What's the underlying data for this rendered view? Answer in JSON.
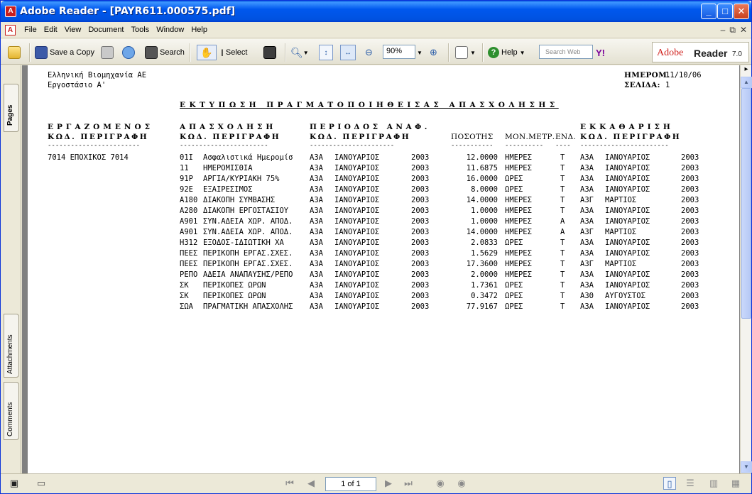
{
  "window": {
    "title": "Adobe Reader - [PAYR611.000575.pdf]",
    "controls": {
      "minimize": "_",
      "maximize": "□",
      "close": "✕"
    }
  },
  "menu": [
    "File",
    "Edit",
    "View",
    "Document",
    "Tools",
    "Window",
    "Help"
  ],
  "toolbar": {
    "save_copy": "Save a Copy",
    "search": "Search",
    "select": "Select",
    "zoom": "90%",
    "help": "Help",
    "search_web_placeholder": "Search Web",
    "yahoo": "Y!",
    "brand": {
      "adobe": "Adobe",
      "reader": "Reader",
      "version": "7.0",
      "accent": "#d0201c"
    }
  },
  "nav_tabs": {
    "pages": "Pages",
    "attachments": "Attachments",
    "comments": "Comments"
  },
  "document": {
    "company": "Ελληνική Βιομηχανία ΑΕ",
    "plant": "Εργοστάσιο Α'",
    "date_label": "ΗΜΕΡΟΜ.",
    "date_value": "11/10/06",
    "page_label": "ΣΕΛΙΔΑ:",
    "page_value": "1",
    "report_title": "ΕΚΤΥΠΩΣΗ ΠΡΑΓΜΑΤΟΠΟΙΗΘΕΙΣΑΣ ΑΠΑΣΧΟΛΗΣΗΣ",
    "group_headers": {
      "employee": "ΕΡΓΑΖΟΜΕΝΟΣ",
      "occupation": "ΑΠΑΣΧΟΛΗΣΗ",
      "period": "ΠΕΡΙΟΔΟΣ ΑΝΑΦ.",
      "settlement": "ΕΚΚΑΘΑΡΙΣΗ"
    },
    "columns": {
      "emp": "ΚΩΔ. ΠΕΡΙΓΡΑΦΗ",
      "occ": "ΚΩΔ. ΠΕΡΙΓΡΑΦΗ",
      "per": "ΚΩΔ. ΠΕΡΙΓΡΑΦΗ",
      "qty": "ΠΟΣΟΤΗΣ",
      "unit": "ΜΟΝ.ΜΕΤΡ.",
      "ind": "ΕΝΔ.",
      "set": "ΚΩΔ. ΠΕΡΙΓΡΑΦΗ"
    },
    "rules": {
      "emp": "------------------------",
      "occ": "-----------------------",
      "per": "----------------------",
      "qty": "-----------",
      "unit": "----------",
      "ind": "----",
      "set": "-----------------------"
    },
    "employee": "7014 ΕΠΟΧΙΚΟΣ 7014",
    "rows": [
      {
        "code": "01Ι",
        "desc": "Ασφαλιστικά Ημερομίσ",
        "pcode": "Α3Α",
        "pdesc": "ΙΑΝΟΥΑΡΙΟΣ",
        "pyear": "2003",
        "qty": "12.0000",
        "unit": "ΗΜΕΡΕΣ",
        "ind": "Τ",
        "scode": "Α3Α",
        "sdesc": "ΙΑΝΟΥΑΡΙΟΣ",
        "syear": "2003"
      },
      {
        "code": "11",
        "desc": "ΗΜΕΡΟΜΙΣΘΙΑ",
        "pcode": "Α3Α",
        "pdesc": "ΙΑΝΟΥΑΡΙΟΣ",
        "pyear": "2003",
        "qty": "11.6875",
        "unit": "ΗΜΕΡΕΣ",
        "ind": "Τ",
        "scode": "Α3Α",
        "sdesc": "ΙΑΝΟΥΑΡΙΟΣ",
        "syear": "2003"
      },
      {
        "code": "91Ρ",
        "desc": "ΑΡΓΙΑ/ΚΥΡΙΑΚΗ 75%",
        "pcode": "Α3Α",
        "pdesc": "ΙΑΝΟΥΑΡΙΟΣ",
        "pyear": "2003",
        "qty": "16.0000",
        "unit": "ΩΡΕΣ",
        "ind": "Τ",
        "scode": "Α3Α",
        "sdesc": "ΙΑΝΟΥΑΡΙΟΣ",
        "syear": "2003"
      },
      {
        "code": "92Ε",
        "desc": "ΕΞΑΙΡΕΣΙΜΟΣ",
        "pcode": "Α3Α",
        "pdesc": "ΙΑΝΟΥΑΡΙΟΣ",
        "pyear": "2003",
        "qty": "8.0000",
        "unit": "ΩΡΕΣ",
        "ind": "Τ",
        "scode": "Α3Α",
        "sdesc": "ΙΑΝΟΥΑΡΙΟΣ",
        "syear": "2003"
      },
      {
        "code": "Α180",
        "desc": "ΔΙΑΚΟΠΗ ΣΥΜΒΑΣΗΣ",
        "pcode": "Α3Α",
        "pdesc": "ΙΑΝΟΥΑΡΙΟΣ",
        "pyear": "2003",
        "qty": "14.0000",
        "unit": "ΗΜΕΡΕΣ",
        "ind": "Τ",
        "scode": "Α3Γ",
        "sdesc": "ΜΑΡΤΙΟΣ",
        "syear": "2003"
      },
      {
        "code": "Α280",
        "desc": "ΔΙΑΚΟΠΗ ΕΡΓΟΣΤΑΣΙΟΥ",
        "pcode": "Α3Α",
        "pdesc": "ΙΑΝΟΥΑΡΙΟΣ",
        "pyear": "2003",
        "qty": "1.0000",
        "unit": "ΗΜΕΡΕΣ",
        "ind": "Τ",
        "scode": "Α3Α",
        "sdesc": "ΙΑΝΟΥΑΡΙΟΣ",
        "syear": "2003"
      },
      {
        "code": "Α901",
        "desc": "ΣΥΝ.ΑΔΕΙΑ ΧΩΡ. ΑΠΟΔ.",
        "pcode": "Α3Α",
        "pdesc": "ΙΑΝΟΥΑΡΙΟΣ",
        "pyear": "2003",
        "qty": "1.0000",
        "unit": "ΗΜΕΡΕΣ",
        "ind": "Α",
        "scode": "Α3Α",
        "sdesc": "ΙΑΝΟΥΑΡΙΟΣ",
        "syear": "2003"
      },
      {
        "code": "Α901",
        "desc": "ΣΥΝ.ΑΔΕΙΑ ΧΩΡ. ΑΠΟΔ.",
        "pcode": "Α3Α",
        "pdesc": "ΙΑΝΟΥΑΡΙΟΣ",
        "pyear": "2003",
        "qty": "14.0000",
        "unit": "ΗΜΕΡΕΣ",
        "ind": "Α",
        "scode": "Α3Γ",
        "sdesc": "ΜΑΡΤΙΟΣ",
        "syear": "2003"
      },
      {
        "code": "Η312",
        "desc": "ΕΞΟΔΟΣ-ΙΔΙΩΤΙΚΗ ΧΑ",
        "pcode": "Α3Α",
        "pdesc": "ΙΑΝΟΥΑΡΙΟΣ",
        "pyear": "2003",
        "qty": "2.0833",
        "unit": "ΩΡΕΣ",
        "ind": "Τ",
        "scode": "Α3Α",
        "sdesc": "ΙΑΝΟΥΑΡΙΟΣ",
        "syear": "2003"
      },
      {
        "code": "ΠΕΕΣ",
        "desc": "ΠΕΡΙΚΟΠΗ ΕΡΓΑΣ.ΣΧΕΣ.",
        "pcode": "Α3Α",
        "pdesc": "ΙΑΝΟΥΑΡΙΟΣ",
        "pyear": "2003",
        "qty": "1.5629",
        "unit": "ΗΜΕΡΕΣ",
        "ind": "Τ",
        "scode": "Α3Α",
        "sdesc": "ΙΑΝΟΥΑΡΙΟΣ",
        "syear": "2003"
      },
      {
        "code": "ΠΕΕΣ",
        "desc": "ΠΕΡΙΚΟΠΗ ΕΡΓΑΣ.ΣΧΕΣ.",
        "pcode": "Α3Α",
        "pdesc": "ΙΑΝΟΥΑΡΙΟΣ",
        "pyear": "2003",
        "qty": "17.3600",
        "unit": "ΗΜΕΡΕΣ",
        "ind": "Τ",
        "scode": "Α3Γ",
        "sdesc": "ΜΑΡΤΙΟΣ",
        "syear": "2003"
      },
      {
        "code": "ΡΕΠΟ",
        "desc": "ΑΔΕΙΑ ΑΝΑΠΑΥΣΗΣ/ΡΕΠΟ",
        "pcode": "Α3Α",
        "pdesc": "ΙΑΝΟΥΑΡΙΟΣ",
        "pyear": "2003",
        "qty": "2.0000",
        "unit": "ΗΜΕΡΕΣ",
        "ind": "Τ",
        "scode": "Α3Α",
        "sdesc": "ΙΑΝΟΥΑΡΙΟΣ",
        "syear": "2003"
      },
      {
        "code": "ΣΚ",
        "desc": "ΠΕΡΙΚΟΠΕΣ ΩΡΩΝ",
        "pcode": "Α3Α",
        "pdesc": "ΙΑΝΟΥΑΡΙΟΣ",
        "pyear": "2003",
        "qty": "1.7361",
        "unit": "ΩΡΕΣ",
        "ind": "Τ",
        "scode": "Α3Α",
        "sdesc": "ΙΑΝΟΥΑΡΙΟΣ",
        "syear": "2003"
      },
      {
        "code": "ΣΚ",
        "desc": "ΠΕΡΙΚΟΠΕΣ ΩΡΩΝ",
        "pcode": "Α3Α",
        "pdesc": "ΙΑΝΟΥΑΡΙΟΣ",
        "pyear": "2003",
        "qty": "0.3472",
        "unit": "ΩΡΕΣ",
        "ind": "Τ",
        "scode": "Α3Θ",
        "sdesc": "ΑΥΓΟΥΣΤΟΣ",
        "syear": "2003"
      },
      {
        "code": "ΣΩΑ",
        "desc": "ΠΡΑΓΜΑΤΙΚΗ ΑΠΑΣΧΟΛΗΣ",
        "pcode": "Α3Α",
        "pdesc": "ΙΑΝΟΥΑΡΙΟΣ",
        "pyear": "2003",
        "qty": "77.9167",
        "unit": "ΩΡΕΣ",
        "ind": "Τ",
        "scode": "Α3Α",
        "sdesc": "ΙΑΝΟΥΑΡΙΟΣ",
        "syear": "2003"
      }
    ]
  },
  "statusbar": {
    "page_indicator": "1 of 1"
  }
}
